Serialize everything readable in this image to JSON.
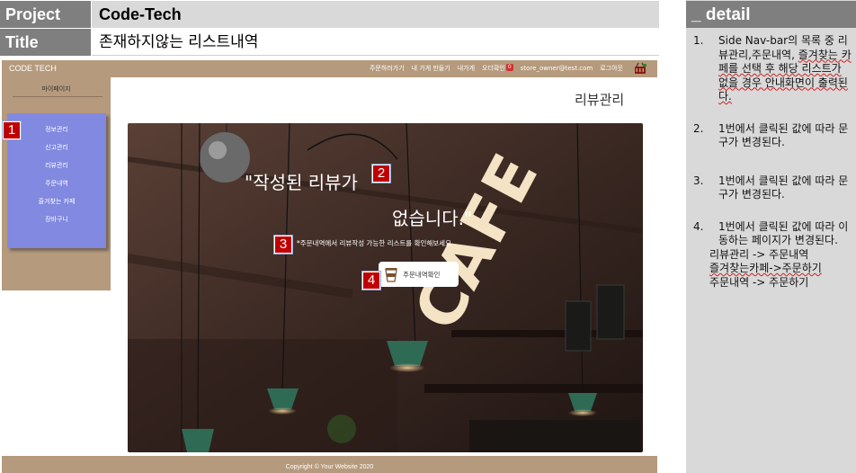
{
  "header": {
    "project_label": "Project",
    "project_value": "Code-Tech",
    "title_label": "Title",
    "title_value": "존재하지않는 리스트내역"
  },
  "detail": {
    "title": "_ detail",
    "items": [
      {
        "num": "1.",
        "text_a": "Side Nav-bar의 목록 중 리뷰관리,주문내역,",
        "text_b": "즐겨찾는 카페를 선택 후 해당 리스트가 없을 경우 안내화면이 출력된다."
      },
      {
        "num": "2.",
        "text": "1번에서 클릭된 값에 따라 문구가 변경된다."
      },
      {
        "num": "3.",
        "text": "1번에서 클릭된 값에 따라 문구가 변경된다."
      },
      {
        "num": "4.",
        "text": "1번에서 클릭된 값에 따라 이동하는 페이지가 변경된다."
      }
    ],
    "mappings": [
      "리뷰관리 -> 주문내역",
      "즐겨찾는카페->주문하기",
      "주문내역 -> 주문하기"
    ]
  },
  "navbar": {
    "brand": "CODE TECH",
    "links": [
      "주문하러가기",
      "내 가게 만들기",
      "내가게",
      "오더확인"
    ],
    "order_badge": "0",
    "email": "store_owner@test.com",
    "logout": "로그아웃",
    "cart_icon": "shopping-basket-icon"
  },
  "sidebar": {
    "heading": "마이페이지",
    "items": [
      "정보관리",
      "신고관리",
      "리뷰관리",
      "주문내역",
      "즐겨찾는 카페",
      "장바구니"
    ]
  },
  "main": {
    "page_title": "리뷰관리",
    "hero_line1": "\"작성된 리뷰가",
    "hero_line2": "없습니다.\"",
    "hero_sub": "*주문내역에서 리뷰작성 가능한 리스트를 확인해보세요",
    "button_label": "주문내역확인",
    "button_icon": "coffee-cup-icon",
    "sign_text": "CAFE"
  },
  "footer": {
    "text": "Copyright © Your Website 2020"
  },
  "callouts": [
    "1",
    "2",
    "3",
    "4"
  ],
  "colors": {
    "header_dark": "#7f7f7f",
    "header_light": "#d9d9d9",
    "mock_brown": "#b59a7d",
    "side_menu_blue": "#8189e0",
    "callout_red": "#c00000"
  }
}
